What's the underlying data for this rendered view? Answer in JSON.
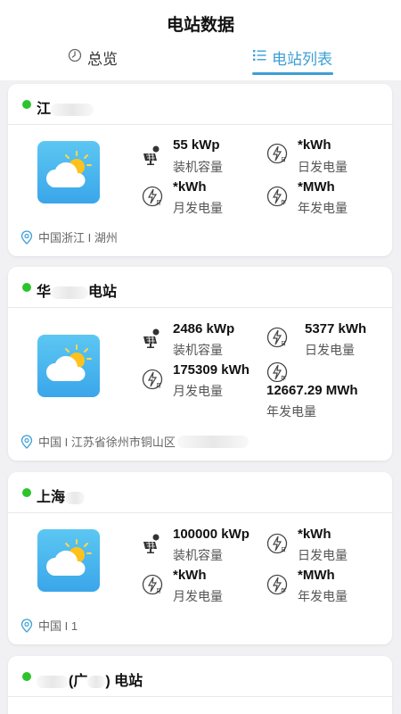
{
  "header": {
    "title": "电站数据",
    "tabs": [
      {
        "label": "总览",
        "icon": "clock-icon",
        "active": false
      },
      {
        "label": "电站列表",
        "icon": "list-icon",
        "active": true
      }
    ],
    "accent": "#3d9fd6"
  },
  "stations": [
    {
      "name": "江",
      "status_color": "#2bc42b",
      "weather_icon": "partly-sunny-icon",
      "capacity": "55 kWp",
      "capacity_label": "装机容量",
      "daily": "*kWh",
      "daily_label": "日发电量",
      "monthly": "*kWh",
      "monthly_label": "月发电量",
      "yearly": "*MWh",
      "yearly_label": "年发电量",
      "location": "中国浙江 I 湖州"
    },
    {
      "name_prefix": "华",
      "name_suffix": "电站",
      "status_color": "#2bc42b",
      "weather_icon": "partly-sunny-icon",
      "capacity": "2486 kWp",
      "capacity_label": "装机容量",
      "daily": "5377 kWh",
      "daily_label": "日发电量",
      "monthly": "175309 kWh",
      "monthly_label": "月发电量",
      "yearly": "12667.29 MWh",
      "yearly_label": "年发电量",
      "location": "中国 I 江苏省徐州市铜山区"
    },
    {
      "name": "上海",
      "status_color": "#2bc42b",
      "weather_icon": "partly-sunny-icon",
      "capacity": "100000 kWp",
      "capacity_label": "装机容量",
      "daily": "*kWh",
      "daily_label": "日发电量",
      "monthly": "*kWh",
      "monthly_label": "月发电量",
      "yearly": "*MWh",
      "yearly_label": "年发电量",
      "location": "中国 I 1"
    },
    {
      "name_part1": "(广",
      "name_part2": ") 电站",
      "status_color": "#2bc42b"
    }
  ]
}
